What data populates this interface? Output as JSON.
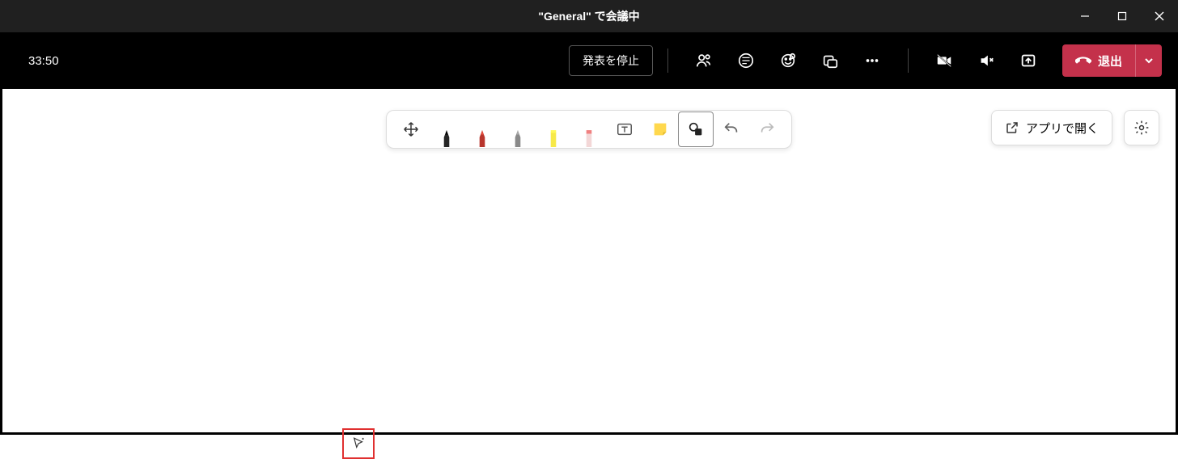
{
  "titlebar": {
    "title": "\"General\" で会議中"
  },
  "toolbar": {
    "timer": "33:50",
    "stop_presenting_label": "発表を停止",
    "leave_label": "退出"
  },
  "whiteboard": {
    "open_in_app_label": "アプリで開く"
  }
}
